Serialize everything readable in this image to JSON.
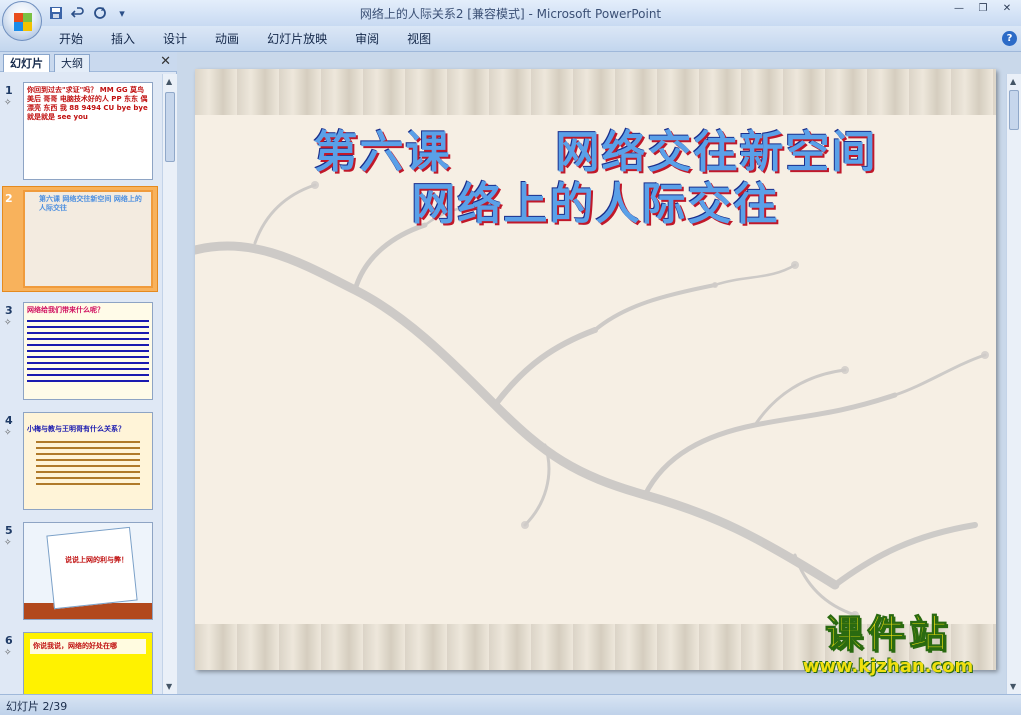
{
  "window": {
    "title": "网络上的人际关系2 [兼容模式] - Microsoft PowerPoint"
  },
  "quick_access": [
    "save-icon",
    "undo-icon",
    "redo-icon",
    "customize-icon"
  ],
  "ribbon": {
    "tabs": [
      "开始",
      "插入",
      "设计",
      "动画",
      "幻灯片放映",
      "审阅",
      "视图"
    ]
  },
  "panel": {
    "tabs": [
      "幻灯片",
      "大纲"
    ],
    "slides": [
      {
        "number": "1",
        "text": "你回到过去\"求证\"吗？ MM GG 莫鸟 美后 哥哥 电脑技术好的人 PP 东东 偶 漂亮 东西 我 88 9494 CU bye bye 就是就是 see you"
      },
      {
        "number": "2",
        "text": "第六课 网络交往新空间 网络上的人际交往"
      },
      {
        "number": "3",
        "text": "网络给我们带来什么呢？"
      },
      {
        "number": "4",
        "text": "小梅与教与王明哥有什么关系？"
      },
      {
        "number": "5",
        "text": "说说上网的利与弊！"
      },
      {
        "number": "6",
        "text": "你说我说，网络的好处在哪"
      }
    ]
  },
  "slide": {
    "title_line1": "第六课      网络交往新空间",
    "title_line2": "网络上的人际交往"
  },
  "watermark": {
    "brand": "课件站",
    "url": "www.kjzhan.com"
  },
  "status": {
    "text": "幻灯片 2/39"
  },
  "colors": {
    "title_fill": "#5aa0e8",
    "title_shadow": "#c0182a",
    "selection": "#f8b25c"
  }
}
